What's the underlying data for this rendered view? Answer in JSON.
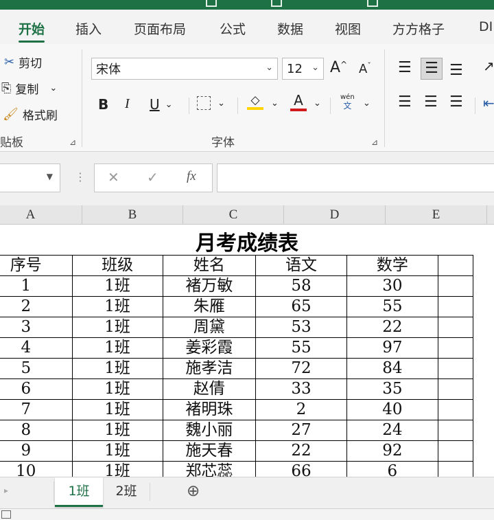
{
  "ribbon_tabs": [
    "开始",
    "插入",
    "页面布局",
    "公式",
    "数据",
    "视图",
    "方方格子",
    "DI"
  ],
  "clipboard": {
    "cut": "剪切",
    "copy": "复制",
    "format_painter": "格式刷",
    "group_label": "贴板"
  },
  "font": {
    "name": "宋体",
    "size": "12",
    "group_label": "字体",
    "bold": "B",
    "italic": "I",
    "underline": "U",
    "grow": "A",
    "shrink": "A",
    "phonetic_top": "wén",
    "phonetic_bottom": "文",
    "font_color_letter": "A"
  },
  "colors": {
    "accent": "#1e7145",
    "highlight": "#ffd400",
    "font_color": "#d11a1a"
  },
  "formula_bar": {
    "cancel": "✕",
    "enter": "✓",
    "fx": "fx",
    "name_box_value": "",
    "formula_value": ""
  },
  "columns": [
    "A",
    "B",
    "C",
    "D",
    "E"
  ],
  "sheet": {
    "title": "月考成绩表",
    "headers": [
      "序号",
      "班级",
      "姓名",
      "语文",
      "数学"
    ],
    "rows": [
      [
        "1",
        "1班",
        "褚万敏",
        "58",
        "30"
      ],
      [
        "2",
        "1班",
        "朱雁",
        "65",
        "55"
      ],
      [
        "3",
        "1班",
        "周黛",
        "53",
        "22"
      ],
      [
        "4",
        "1班",
        "姜彩霞",
        "55",
        "97"
      ],
      [
        "5",
        "1班",
        "施孝洁",
        "72",
        "84"
      ],
      [
        "6",
        "1班",
        "赵倩",
        "33",
        "35"
      ],
      [
        "7",
        "1班",
        "褚明珠",
        "2",
        "40"
      ],
      [
        "8",
        "1班",
        "魏小丽",
        "27",
        "24"
      ],
      [
        "9",
        "1班",
        "施天春",
        "22",
        "92"
      ],
      [
        "10",
        "1班",
        "郑芯蕊",
        "66",
        "6"
      ]
    ]
  },
  "sheet_tabs": [
    "1班",
    "2班"
  ],
  "add_sheet": "⊕"
}
